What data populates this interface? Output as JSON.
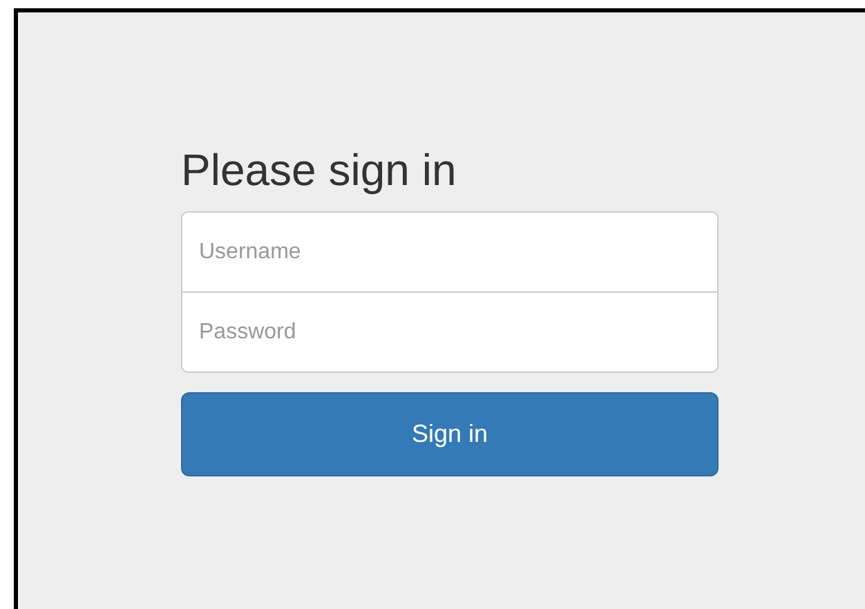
{
  "heading": "Please sign in",
  "fields": [
    {
      "placeholder": "Username"
    },
    {
      "placeholder": "Password"
    }
  ],
  "submit": {
    "label": "Sign in"
  }
}
